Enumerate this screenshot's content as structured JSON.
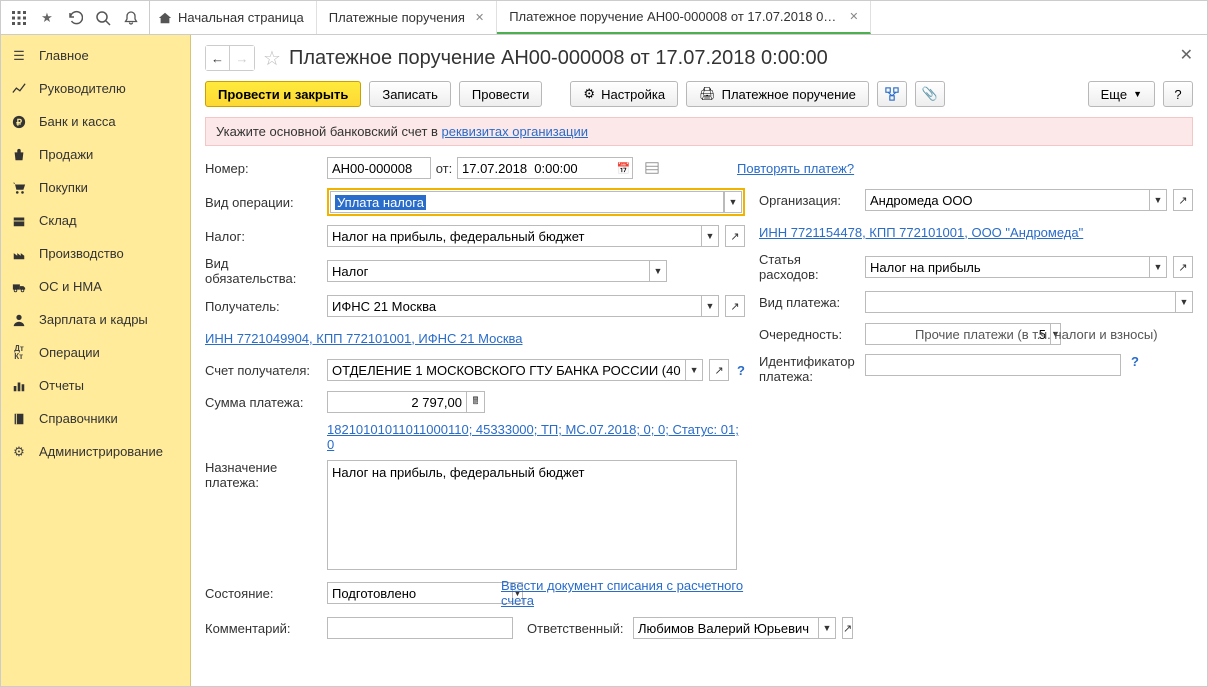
{
  "topbar_tabs": [
    {
      "label": "Начальная страница",
      "home": true,
      "closable": false
    },
    {
      "label": "Платежные поручения",
      "closable": true
    },
    {
      "label": "Платежное поручение АН00-000008 от 17.07.2018 0:00:00",
      "closable": true,
      "active": true
    }
  ],
  "sidebar": [
    {
      "label": "Главное",
      "icon": "menu"
    },
    {
      "label": "Руководителю",
      "icon": "chart-line"
    },
    {
      "label": "Банк и касса",
      "icon": "ruble"
    },
    {
      "label": "Продажи",
      "icon": "bag"
    },
    {
      "label": "Покупки",
      "icon": "cart"
    },
    {
      "label": "Склад",
      "icon": "box"
    },
    {
      "label": "Производство",
      "icon": "factory"
    },
    {
      "label": "ОС и НМА",
      "icon": "truck"
    },
    {
      "label": "Зарплата и кадры",
      "icon": "person"
    },
    {
      "label": "Операции",
      "icon": "dtKt"
    },
    {
      "label": "Отчеты",
      "icon": "barchart"
    },
    {
      "label": "Справочники",
      "icon": "book"
    },
    {
      "label": "Администрирование",
      "icon": "gear"
    }
  ],
  "page": {
    "title": "Платежное поручение АН00-000008 от 17.07.2018 0:00:00",
    "post_close": "Провести и закрыть",
    "record": "Записать",
    "post": "Провести",
    "settings": "Настройка",
    "print": "Платежное поручение",
    "more": "Еще",
    "help": "?"
  },
  "banner": {
    "prefix": "Укажите основной банковский счет в ",
    "link": "реквизитах организации"
  },
  "fields": {
    "number_label": "Номер:",
    "number": "АН00-000008",
    "from_label": "от:",
    "date": "17.07.2018  0:00:00",
    "repeat_link": "Повторять платеж?",
    "op_type_label": "Вид операции:",
    "op_type": "Уплата налога",
    "org_label": "Организация:",
    "org": "Андромеда ООО",
    "org_link": "ИНН 7721154478, КПП 772101001, ООО \"Андромеда\"",
    "tax_label": "Налог:",
    "tax": "Налог на прибыль, федеральный бюджет",
    "obl_label": "Вид обязательства:",
    "obl": "Налог",
    "recip_label": "Получатель:",
    "recip": "ИФНС 21 Москва",
    "recip_link": "ИНН 7721049904, КПП 772101001, ИФНС 21 Москва",
    "recip_acc_label": "Счет получателя:",
    "recip_acc": "ОТДЕЛЕНИЕ 1 МОСКОВСКОГО ГТУ БАНКА РОССИИ (40",
    "amount_label": "Сумма платежа:",
    "amount": "2 797,00",
    "kbk_link": "18210101011011000110; 45333000; ТП; МС.07.2018; 0; 0; Статус: 01; 0",
    "purpose_label": "Назначение платежа:",
    "purpose": "Налог на прибыль, федеральный бюджет",
    "state_label": "Состояние:",
    "state": "Подготовлено",
    "state_link": "Ввести документ списания с расчетного счета",
    "comment_label": "Комментарий:",
    "comment": "",
    "resp_label": "Ответственный:",
    "resp": "Любимов Валерий Юрьевич",
    "exp_item_label": "Статья расходов:",
    "exp_item": "Налог на прибыль",
    "pay_type_label": "Вид платежа:",
    "pay_type": "",
    "priority_label": "Очередность:",
    "priority": "5",
    "priority_hint": "Прочие платежи (в т.ч. налоги и взносы)",
    "payment_id_label": "Идентификатор платежа:",
    "payment_id": ""
  }
}
